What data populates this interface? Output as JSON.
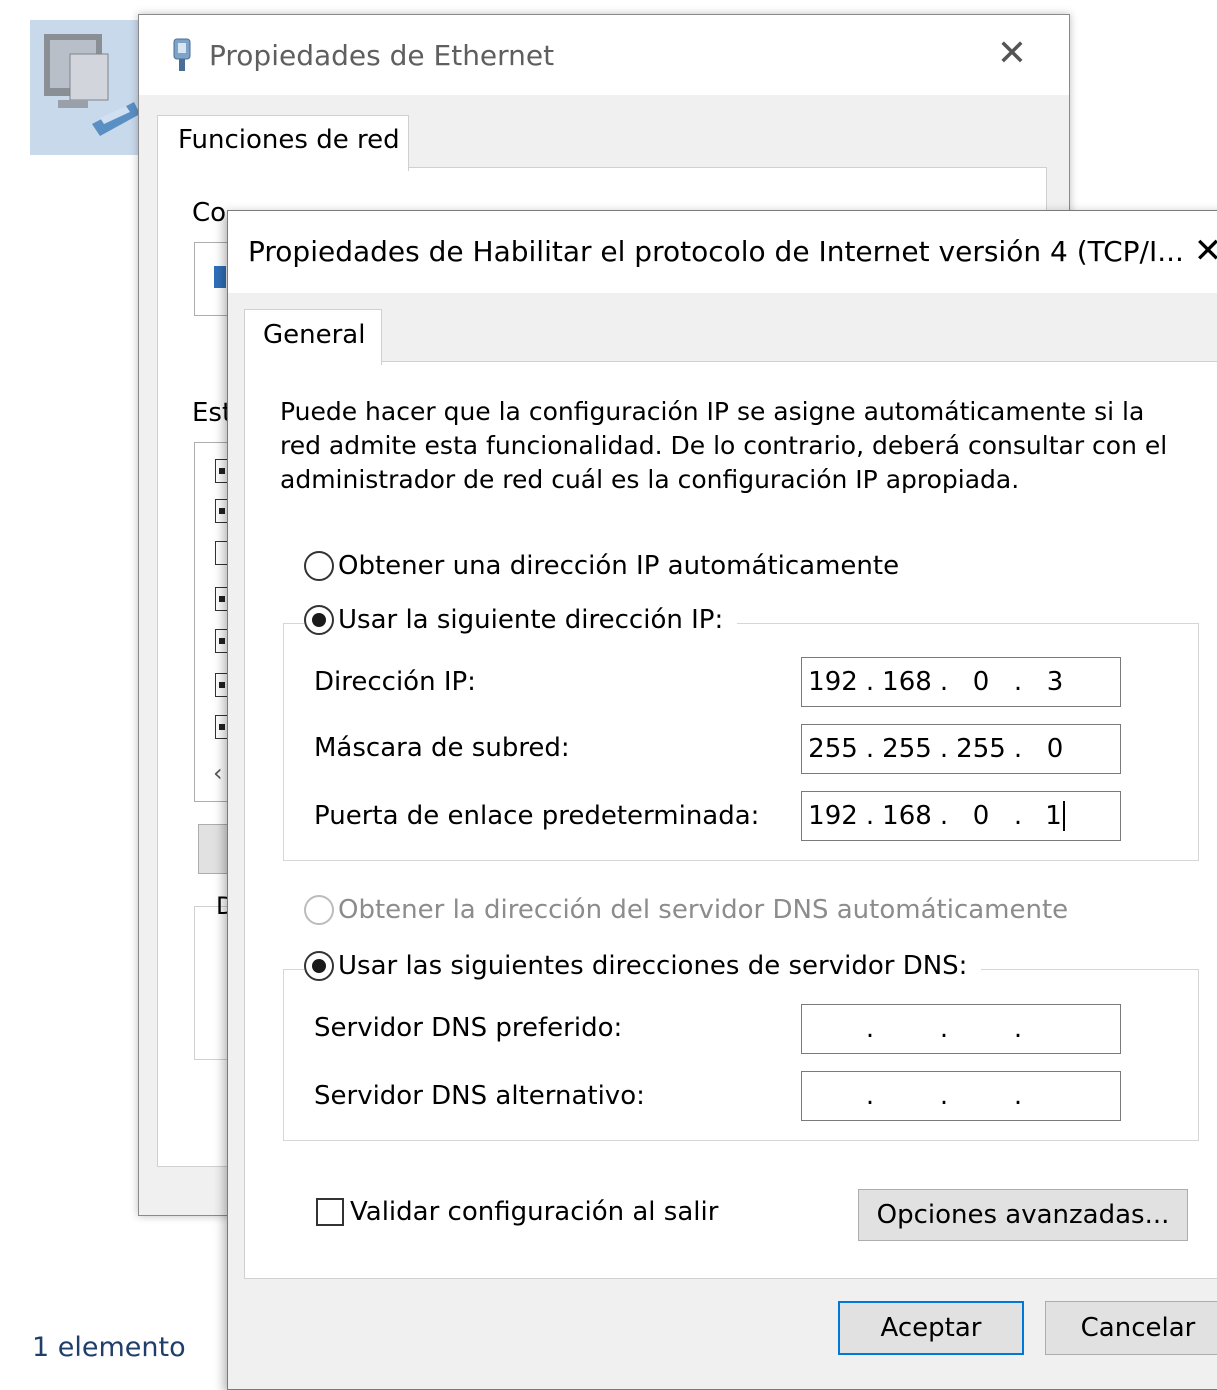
{
  "background": {
    "status_text": "1 elemento"
  },
  "ethernet_dialog": {
    "title": "Propiedades de Ethernet",
    "close_glyph": "✕",
    "tab_label": "Funciones de red",
    "connect_label": "Co",
    "items_label": "Est",
    "desc_label": "D",
    "scroll_arrow": "‹",
    "item_checks": [
      true,
      true,
      false,
      true,
      true,
      true,
      true
    ]
  },
  "ipv4_dialog": {
    "title": "Propiedades de Habilitar el protocolo de Internet versión 4 (TCP/I...",
    "close_glyph": "✕",
    "tab_label": "General",
    "description": "Puede hacer que la configuración IP se asigne automáticamente si la red admite esta funcionalidad. De lo contrario, deberá consultar con el administrador de red cuál es la configuración IP apropiada.",
    "ip_auto_option": {
      "label": "Obtener una dirección IP automáticamente",
      "selected": false
    },
    "ip_manual_option": {
      "label": "Usar la siguiente dirección IP:",
      "selected": true
    },
    "ip_fields": [
      {
        "label": "Dirección IP:",
        "octets": [
          "192",
          "168",
          "0",
          "3"
        ]
      },
      {
        "label": "Máscara de subred:",
        "octets": [
          "255",
          "255",
          "255",
          "0"
        ]
      },
      {
        "label": "Puerta de enlace predeterminada:",
        "octets": [
          "192",
          "168",
          "0",
          "1"
        ]
      }
    ],
    "dns_auto_option": {
      "label": "Obtener la dirección del servidor DNS automáticamente",
      "selected": false,
      "disabled": true
    },
    "dns_manual_option": {
      "label": "Usar las siguientes direcciones de servidor DNS:",
      "selected": true
    },
    "dns_fields": [
      {
        "label": "Servidor DNS preferido:",
        "octets": [
          "",
          "",
          "",
          ""
        ]
      },
      {
        "label": "Servidor DNS alternativo:",
        "octets": [
          "",
          "",
          "",
          ""
        ]
      }
    ],
    "validate_checkbox": {
      "label": "Validar configuración al salir",
      "checked": false
    },
    "advanced_button": "Opciones avanzadas...",
    "ok_button": "Aceptar",
    "cancel_button": "Cancelar"
  }
}
